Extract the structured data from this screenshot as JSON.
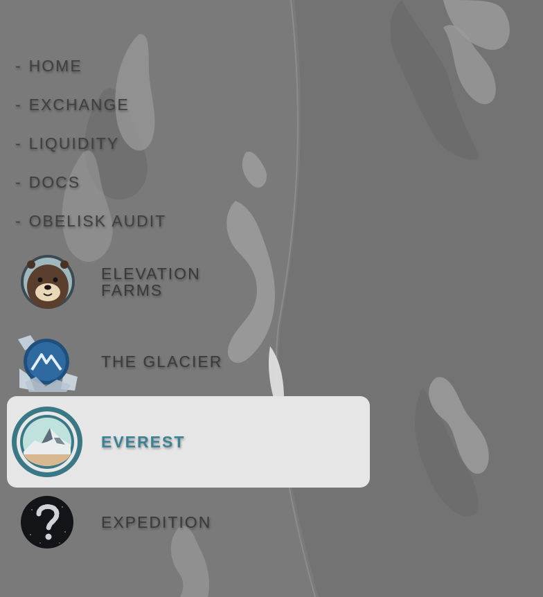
{
  "nav": {
    "dash": "-",
    "links": [
      "HOME",
      "EXCHANGE",
      "LIQUIDITY",
      "DOCS",
      "OBELISK AUDIT"
    ]
  },
  "cards": [
    {
      "label": "ELEVATION FARMS",
      "icon": "otter-icon",
      "active": false
    },
    {
      "label": "THE GLACIER",
      "icon": "glacier-icon",
      "active": false
    },
    {
      "label": "EVEREST",
      "icon": "everest-mountain-icon",
      "active": true
    },
    {
      "label": "EXPEDITION",
      "icon": "mystery-question-icon",
      "active": false
    }
  ],
  "colors": {
    "background": "#777777",
    "active_card": "#e6e6e6",
    "active_text": "#3d8294",
    "text": "#3f3f3f"
  }
}
